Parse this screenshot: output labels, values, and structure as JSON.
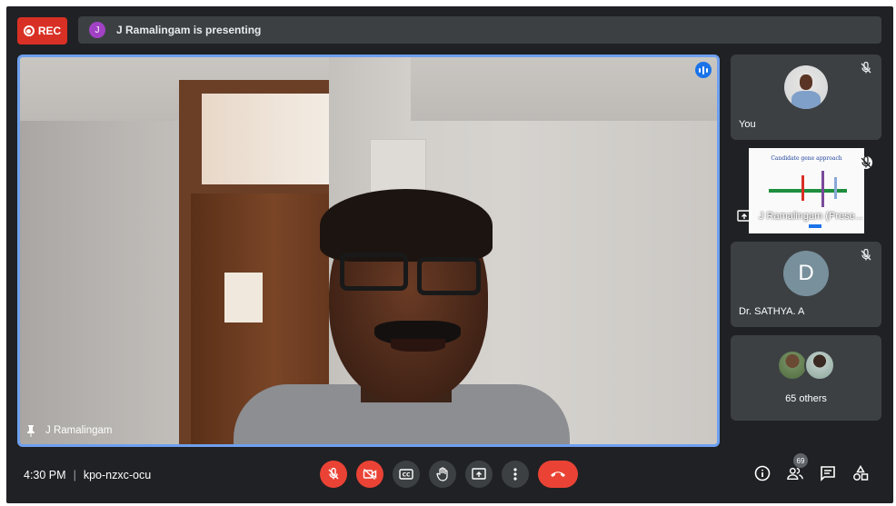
{
  "recording": {
    "label": "REC"
  },
  "presenting_bar": {
    "initial": "J",
    "text": "J Ramalingam is presenting"
  },
  "main_tile": {
    "name": "J Ramalingam"
  },
  "side_tiles": {
    "you": {
      "label": "You"
    },
    "presentation": {
      "label": "J Ramalingam (Prese...",
      "slide_title": "Candidate gene approach"
    },
    "participant": {
      "initial": "D",
      "label": "Dr. SATHYA. A"
    },
    "others": {
      "label": "65 others"
    }
  },
  "bottom_bar": {
    "time": "4:30 PM",
    "meeting_code": "kpo-nzxc-ocu",
    "participant_count": "69"
  },
  "icons": [
    "record-icon",
    "speaking-icon",
    "pin-icon",
    "mic-off-icon",
    "present-icon",
    "camera-off-icon",
    "captions-icon",
    "raise-hand-icon",
    "present-now-icon",
    "more-options-icon",
    "end-call-icon",
    "info-icon",
    "people-icon",
    "chat-icon",
    "activities-icon"
  ],
  "colors": {
    "rec": "#d93025",
    "end_call": "#ea4335",
    "active_speaker": "#6ea0f0",
    "background": "#202124"
  }
}
